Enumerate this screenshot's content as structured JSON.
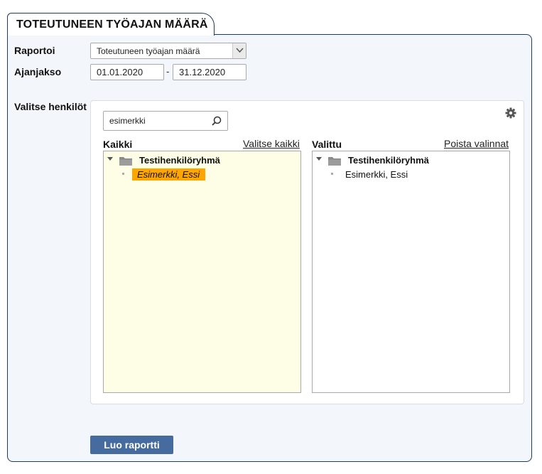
{
  "tab": {
    "title": "TOTEUTUNEEN TYÖAJAN MÄÄRÄ"
  },
  "form": {
    "report_label": "Raportoi",
    "report_value": "Toteutuneen työajan määrä",
    "period_label": "Ajanjakso",
    "date_from": "01.01.2020",
    "date_separator": "-",
    "date_to": "31.12.2020"
  },
  "persons": {
    "label": "Valitse henkilöt",
    "search_value": "esimerkki",
    "all": {
      "heading": "Kaikki",
      "action": "Valitse kaikki",
      "group": "Testihenkilöryhmä",
      "items": [
        "Esimerkki, Essi"
      ]
    },
    "selected": {
      "heading": "Valittu",
      "action": "Poista valinnat",
      "group": "Testihenkilöryhmä",
      "items": [
        "Esimerkki, Essi"
      ]
    }
  },
  "actions": {
    "create_report": "Luo raportti"
  },
  "colors": {
    "border": "#1f3a5f",
    "panel_bg": "#f3f6fa",
    "available_list_bg": "#fefee6",
    "highlight": "#ffa500",
    "button_bg": "#456b9f"
  },
  "icons": [
    "chevron-down-icon",
    "search-icon",
    "gear-icon",
    "caret-down-icon",
    "folder-icon"
  ]
}
